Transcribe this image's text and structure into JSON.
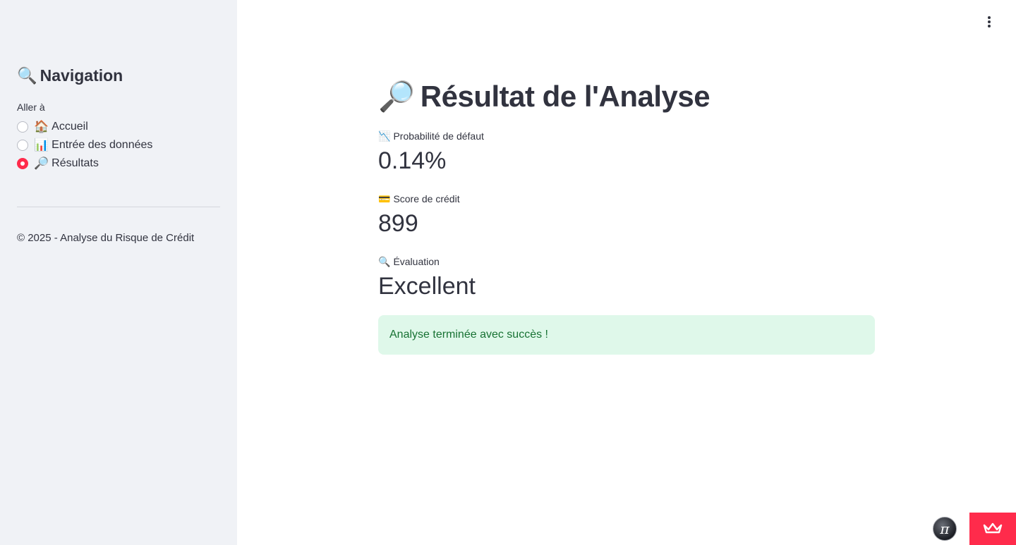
{
  "sidebar": {
    "title": "Navigation",
    "title_icon": "magnifier-left-icon",
    "radio_label": "Aller à",
    "items": [
      {
        "icon": "🏠",
        "label": "Accueil",
        "checked": false
      },
      {
        "icon": "📊",
        "label": "Entrée des données",
        "checked": false
      },
      {
        "icon": "🔎",
        "label": "Résultats",
        "checked": true
      }
    ],
    "footer": "© 2025 - Analyse du Risque de Crédit"
  },
  "main": {
    "title_icon": "🔎",
    "title": "Résultat de l'Analyse",
    "metrics": [
      {
        "icon": "📉",
        "label": "Probabilité de défaut",
        "value": "0.14%"
      },
      {
        "icon": "💳",
        "label": "Score de crédit",
        "value": "899"
      },
      {
        "icon": "🔍",
        "label": "Évaluation",
        "value": "Excellent"
      }
    ],
    "success_message": "Analyse terminée avec succès !"
  },
  "colors": {
    "accent": "#ff2b4b",
    "sidebar_bg": "#f0f2f6",
    "success_bg": "#dff8ea",
    "success_text": "#177233"
  }
}
